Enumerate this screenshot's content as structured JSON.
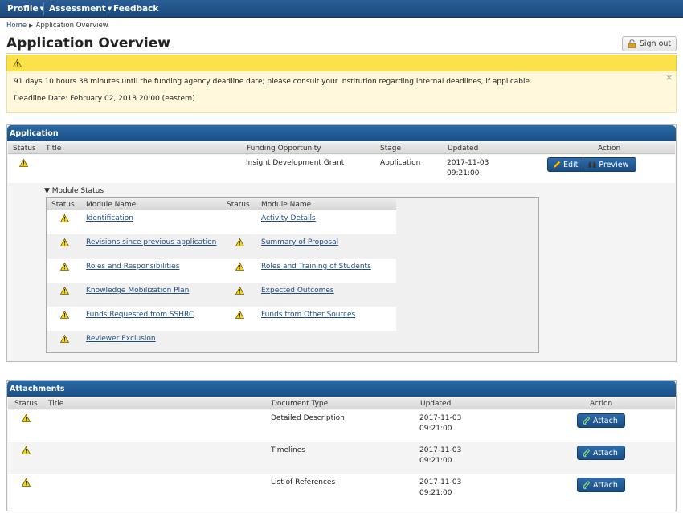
{
  "nav": {
    "profile": "Profile",
    "assessment": "Assessment",
    "feedback": "Feedback"
  },
  "breadcrumb": {
    "home": "Home",
    "current": "Application Overview"
  },
  "page_title": "Application Overview",
  "sign_out": "Sign out",
  "alert": {
    "line1": "91 days 10 hours 38 minutes until the funding agency deadline date; please consult your institution regarding internal deadlines, if applicable.",
    "line2": "Deadline Date: February 02, 2018 20:00 (eastern)",
    "close": "×"
  },
  "application": {
    "heading": "Application",
    "columns": {
      "status": "Status",
      "title": "Title",
      "funding": "Funding Opportunity",
      "stage": "Stage",
      "updated": "Updated",
      "action": "Action"
    },
    "row": {
      "title": "",
      "funding": "Insight Development Grant",
      "stage": "Application",
      "updated_date": "2017-11-03",
      "updated_time": "09:21:00",
      "edit": "Edit",
      "preview": "Preview"
    }
  },
  "module_status": {
    "toggle": "Module Status",
    "columns": {
      "status1": "Status",
      "name1": "Module Name",
      "status2": "Status",
      "name2": "Module Name"
    },
    "rows": [
      {
        "left": "Identification",
        "right": "Activity Details"
      },
      {
        "left": "Revisions since previous application",
        "right": "Summary of Proposal"
      },
      {
        "left": "Roles and Responsibilities",
        "right": "Roles and Training of Students"
      },
      {
        "left": "Knowledge Mobilization Plan",
        "right": "Expected Outcomes"
      },
      {
        "left": "Funds Requested from SSHRC",
        "right": "Funds from Other Sources"
      },
      {
        "left": "Reviewer Exclusion",
        "right": ""
      }
    ]
  },
  "attachments": {
    "heading": "Attachments",
    "columns": {
      "status": "Status",
      "title": "Title",
      "doctype": "Document Type",
      "updated": "Updated",
      "action": "Action"
    },
    "rows": [
      {
        "doctype": "Detailed Description",
        "date": "2017-11-03",
        "time": "09:21:00",
        "action": "Attach"
      },
      {
        "doctype": "Timelines",
        "date": "2017-11-03",
        "time": "09:21:00",
        "action": "Attach"
      },
      {
        "doctype": "List of References",
        "date": "2017-11-03",
        "time": "09:21:00",
        "action": "Attach"
      }
    ]
  },
  "icons": {
    "warning": "warning-icon",
    "lock": "lock-icon",
    "pencil": "pencil-icon",
    "binoculars": "binoculars-icon",
    "paperclip": "paperclip-icon"
  },
  "colors": {
    "nav_blue": "#1c4a7c",
    "alert_yellow": "#fbe14a",
    "link_blue": "#1f4d80"
  }
}
